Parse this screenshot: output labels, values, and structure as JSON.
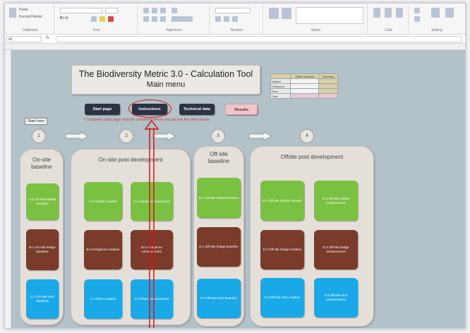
{
  "ribbon": {
    "groups": [
      {
        "label": "Clipboard"
      },
      {
        "label": "Font"
      },
      {
        "label": "Alignment"
      },
      {
        "label": "Number"
      },
      {
        "label": "Styles"
      },
      {
        "label": "Cells"
      },
      {
        "label": "Editing"
      }
    ],
    "paste_label": "Paste",
    "format_painter_label": "Format Painter"
  },
  "formula_bar": {
    "name_box": "A1",
    "fx": "fx"
  },
  "sheet": {
    "title": "The Biodiversity Metric 3.0 - Calculation Tool",
    "subtitle": "Main menu",
    "buttons": {
      "start_page": "Start page",
      "instructions": "Instructions",
      "technical_data": "Technical data",
      "results": "Results"
    },
    "note": "* Completed 'Start page' must be completed before you can use the other sheets",
    "start_label": "Start here",
    "summary_table": {
      "header": [
        "",
        "Offsite baseline",
        "Summary"
      ],
      "rows": [
        {
          "label": "Habitat",
          "value": "",
          "summary": ""
        },
        {
          "label": "Hedgerow",
          "value": "",
          "summary": ""
        },
        {
          "label": "River",
          "value": "",
          "summary": ""
        },
        {
          "label": "Total",
          "value": "",
          "summary": ""
        }
      ]
    },
    "steps": [
      "1",
      "2",
      "3",
      "4"
    ],
    "panels": [
      {
        "title": "On-site baseline",
        "tiles": [
          "A-1 On-site habitat baseline",
          "B-1 On-site hedge baseline",
          "C-1 On-site river baseline"
        ]
      },
      {
        "title": "On-site post development",
        "tiles": [
          "A-2 Habitat creation",
          "A-3 Habitat enhancement",
          "B-2 Hedgerow creation",
          "B-3 Hedgerow enhancement",
          "C-2 River creation",
          "C-3 River enhancement"
        ]
      },
      {
        "title": "Off-site baseline",
        "tiles": [
          "D-1 Off-site habitat baseline",
          "E-1 Off-site hedge baseline",
          "F-1 Off-site river baseline"
        ]
      },
      {
        "title": "Offsite post development",
        "tiles": [
          "D-2 Off-site habitat creation",
          "D-3 Off-site habitat enhancement",
          "E-2 Off-site hedge creation",
          "E-3 Off-site hedge enhancement",
          "F-2 Off-site river creation",
          "F-3 Off-site river enhancement"
        ]
      }
    ]
  },
  "colors": {
    "sheet_bg": "#b3c2c8",
    "panel_bg": "#e4dfd8",
    "habitat_green": "#7ac142",
    "hedgerow_brown": "#7a3b2a",
    "river_blue": "#1aa9e8",
    "button_dark": "#2c3344",
    "results_pink": "#f2c4cc",
    "annotation_red": "#d01818"
  },
  "icons": {
    "arrow": "right-arrow-icon",
    "paste": "paste-icon"
  }
}
